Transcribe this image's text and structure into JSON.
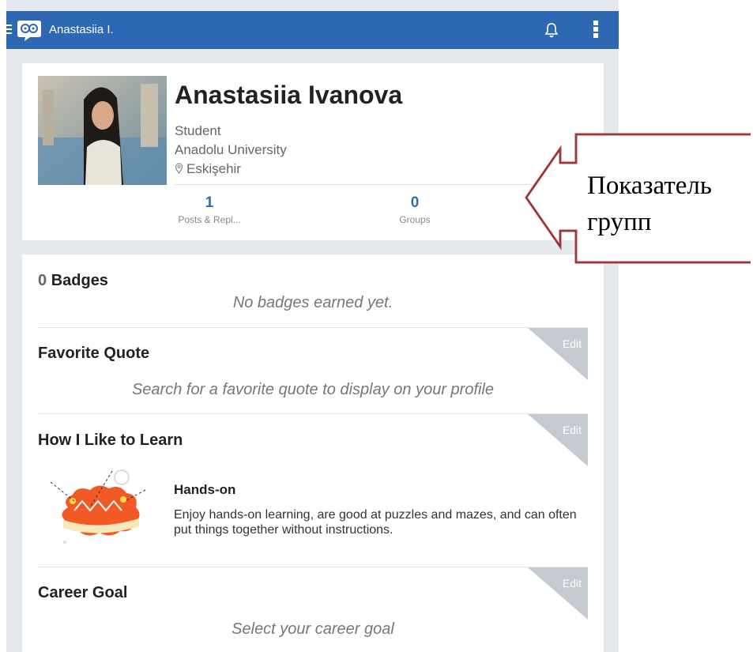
{
  "topbar": {
    "title": "Anastasiia I.",
    "icons": [
      "menu-icon",
      "logo-icon",
      "bell-icon",
      "more-icon"
    ]
  },
  "profile": {
    "name": "Anastasiia Ivanova",
    "role": "Student",
    "school": "Anadolu University",
    "location": "Eskişehir",
    "stats": [
      {
        "value": "1",
        "label": "Posts & Repl..."
      },
      {
        "value": "0",
        "label": "Groups"
      }
    ]
  },
  "badges": {
    "count": "0",
    "title": "Badges",
    "empty_text": "No badges earned yet."
  },
  "favorite_quote": {
    "title": "Favorite Quote",
    "edit_label": "Edit",
    "placeholder": "Search for a favorite quote to display on your profile"
  },
  "learn": {
    "title": "How I Like to Learn",
    "edit_label": "Edit",
    "style_name": "Hands-on",
    "style_description": "Enjoy hands-on learning, are good at puzzles and mazes, and can often put things together without instructions."
  },
  "career": {
    "title": "Career Goal",
    "edit_label": "Edit",
    "placeholder": "Select your career goal"
  },
  "annotation": {
    "text": "Показатель\nгрупп"
  },
  "colors": {
    "topbar": "#2e67b2",
    "stat_number": "#2f6fb3",
    "callout_border": "#b44a4a",
    "edit_corner": "#c5cad1"
  }
}
